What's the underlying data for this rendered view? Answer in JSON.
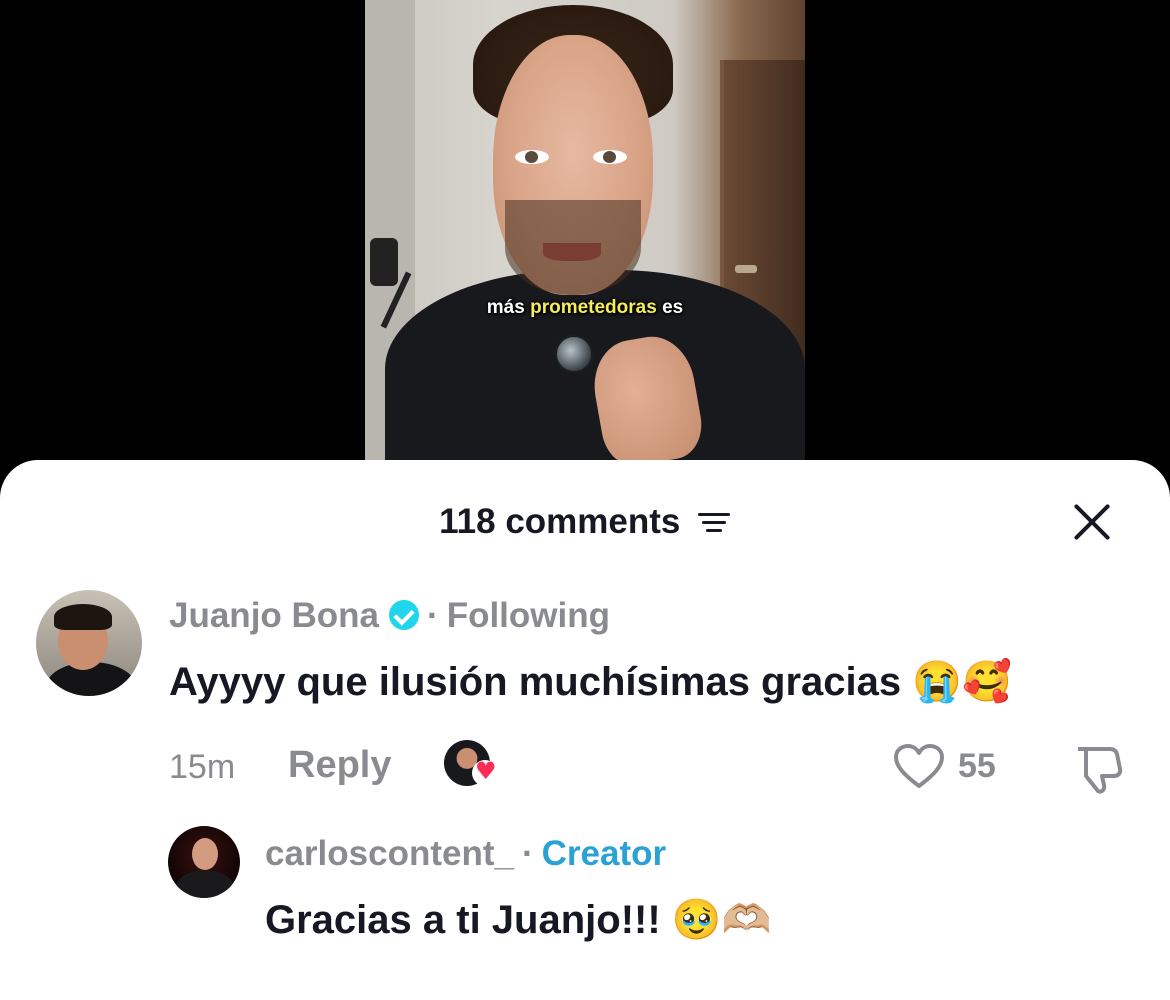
{
  "video": {
    "caption_prefix": "más",
    "caption_highlight": "prometedoras",
    "caption_suffix": "es"
  },
  "comments_sheet": {
    "count_label": "118 comments",
    "filter_icon": "filter-icon",
    "close_icon": "close-icon"
  },
  "comments": [
    {
      "username": "Juanjo Bona",
      "verified": true,
      "separator": "·",
      "relation": "Following",
      "text": "Ayyyy que ilusión muchísimas gracias 😭🥰",
      "time": "15m",
      "reply_label": "Reply",
      "liked_by_creator": true,
      "like_count": "55"
    },
    {
      "username": "carloscontent_",
      "separator": "·",
      "role": "Creator",
      "text": "Gracias a ti Juanjo!!! 🥹🫶🏼"
    }
  ],
  "colors": {
    "accent_creator": "#2aa2d6",
    "verified": "#20d5ec",
    "like_heart": "#fe2c55",
    "muted_text": "#8a8b91",
    "primary_text": "#161823"
  }
}
